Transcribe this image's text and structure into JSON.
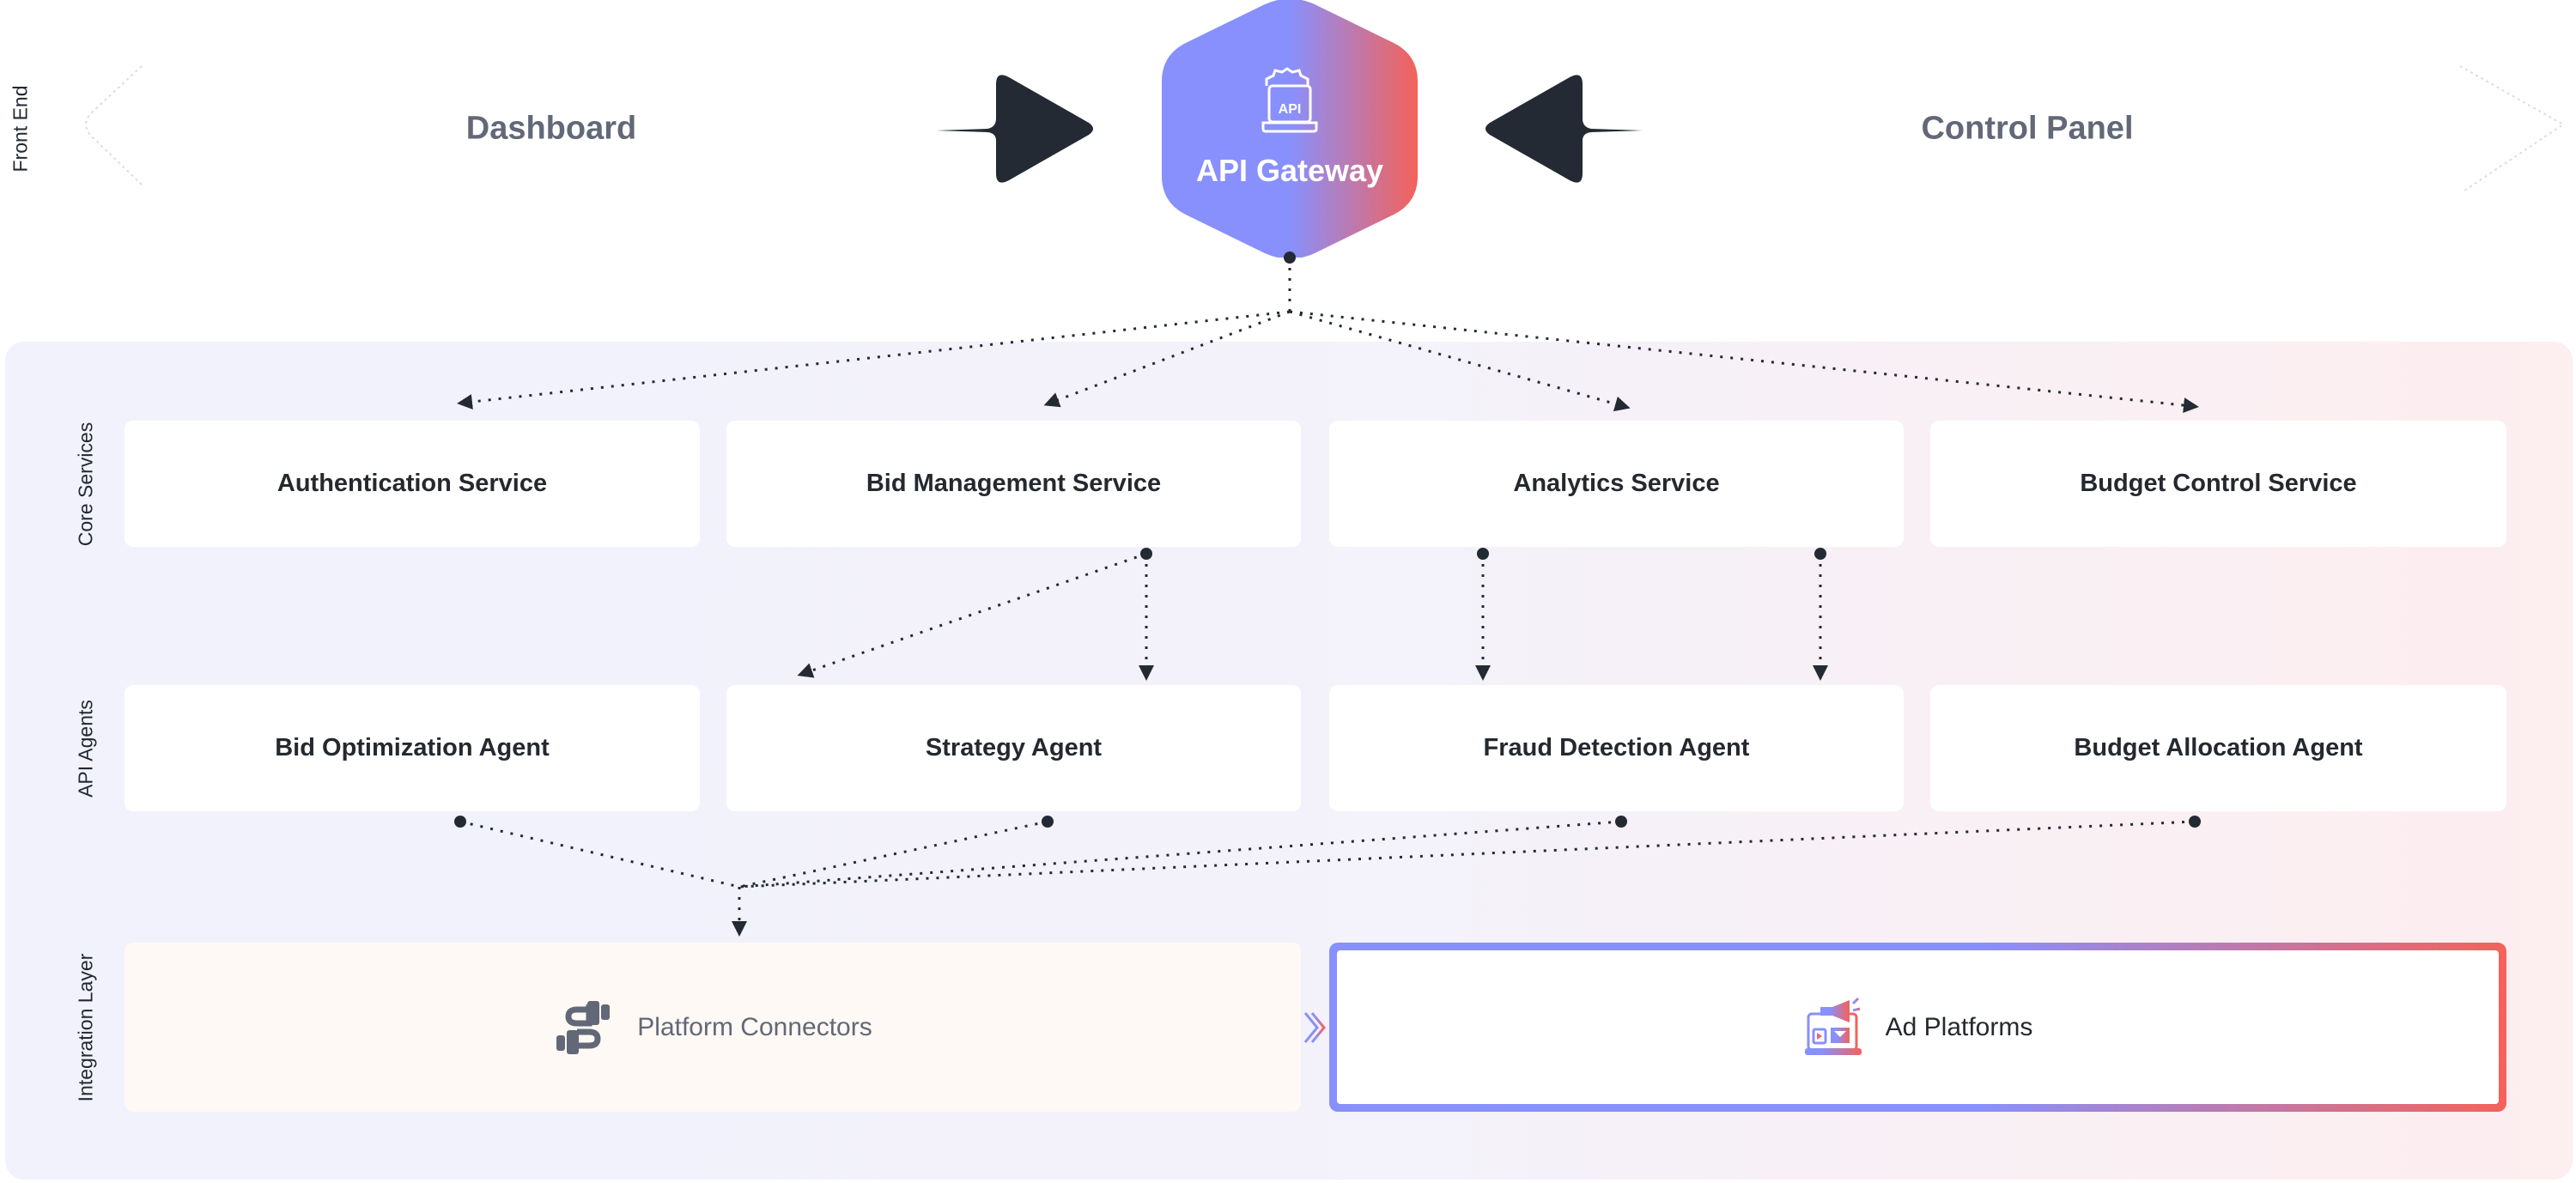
{
  "front_end": {
    "label": "Front End",
    "dashboard": "Dashboard",
    "control_panel": "Control Panel",
    "gateway": {
      "title": "API Gateway",
      "icon_text": "API",
      "icon": "laptop-gear-api-icon"
    }
  },
  "layers": {
    "core_services": {
      "label": "Core Services",
      "items": [
        "Authentication Service",
        "Bid Management Service",
        "Analytics Service",
        "Budget Control Service"
      ]
    },
    "api_agents": {
      "label": "API Agents",
      "items": [
        "Bid Optimization Agent",
        "Strategy Agent",
        "Fraud Detection Agent",
        "Budget Allocation Agent"
      ]
    },
    "integration": {
      "label": "Integration Layer",
      "connectors": {
        "label": "Platform Connectors",
        "icon": "plug-cable-icon"
      },
      "ad_platforms": {
        "label": "Ad Platforms",
        "icon": "megaphone-laptop-icon"
      }
    }
  },
  "colors": {
    "gradient_start": "#8890fd",
    "gradient_end": "#f4625a",
    "dark": "#232a33",
    "muted_text": "#626877"
  }
}
